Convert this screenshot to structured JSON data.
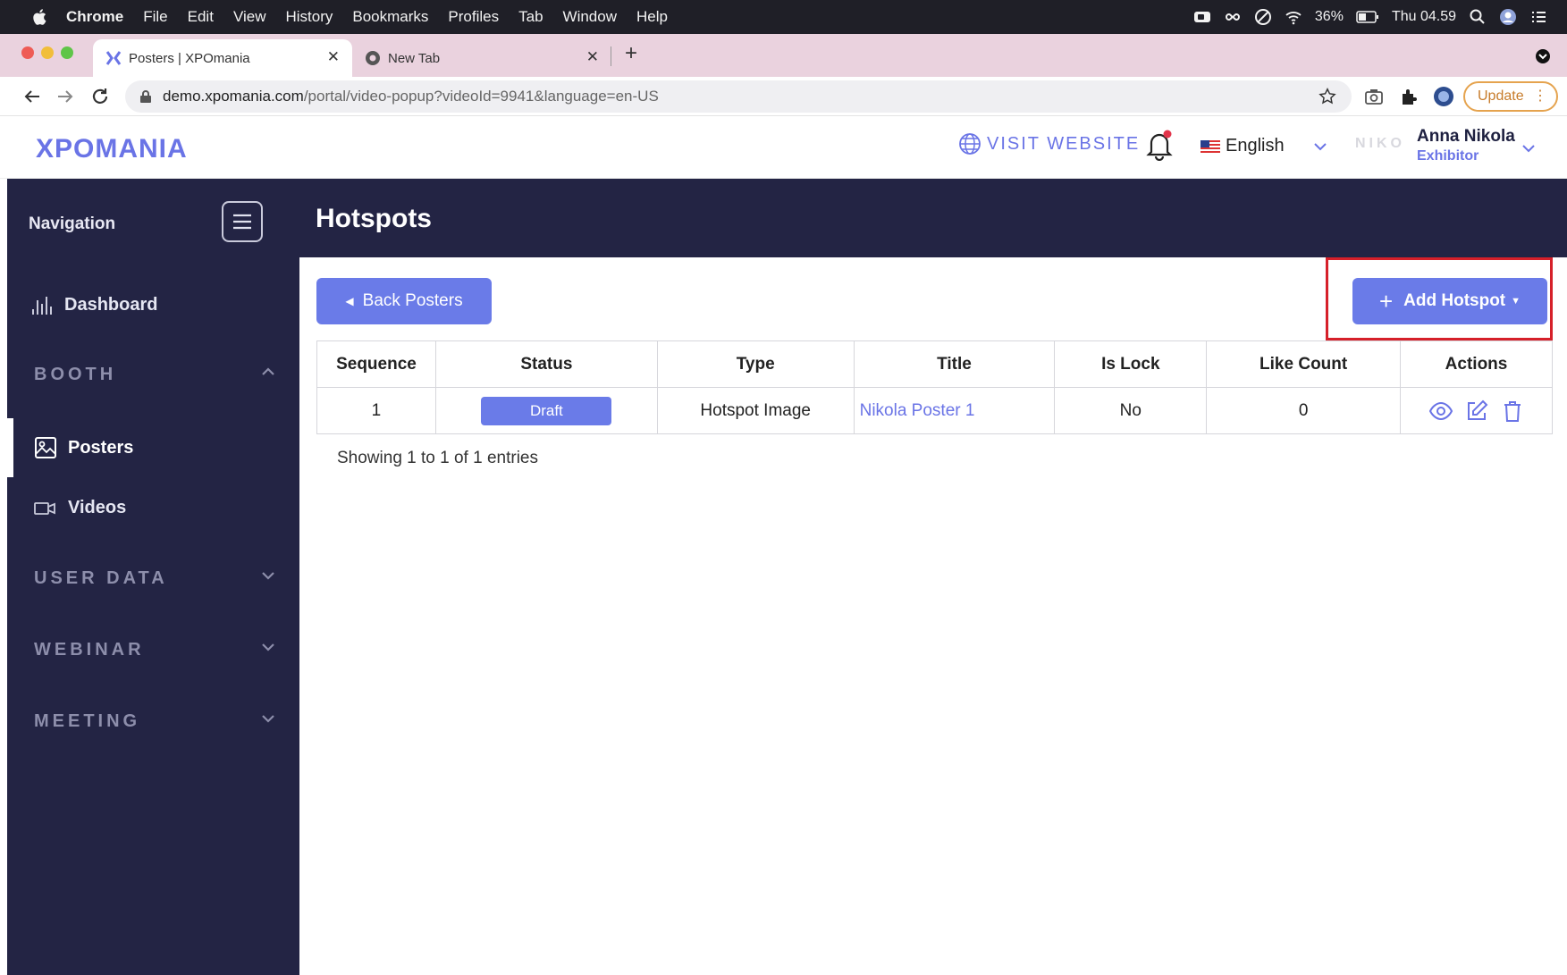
{
  "menubar": {
    "app": "Chrome",
    "items": [
      "File",
      "Edit",
      "View",
      "History",
      "Bookmarks",
      "Profiles",
      "Tab",
      "Window",
      "Help"
    ],
    "battery": "36%",
    "clock": "Thu 04.59"
  },
  "browser": {
    "tabs": [
      {
        "label": "Posters | XPOmania",
        "active": true
      },
      {
        "label": "New Tab",
        "active": false
      }
    ],
    "url_host": "demo.xpomania.com",
    "url_path": "/portal/video-popup?videoId=9941&language=en-US",
    "update_label": "Update"
  },
  "header": {
    "logo_text": "XPOMANIA",
    "visit_website": "VISIT WEBSITE",
    "language": "English",
    "company_faint": "NIKO",
    "user_name": "Anna Nikola",
    "user_role": "Exhibitor"
  },
  "sidebar": {
    "title": "Navigation",
    "dashboard": "Dashboard",
    "sections": {
      "booth": "BOOTH",
      "user_data": "USER DATA",
      "webinar": "WEBINAR",
      "meeting": "MEETING"
    },
    "posters": "Posters",
    "videos": "Videos"
  },
  "page": {
    "title": "Hotspots",
    "back_button": "Back Posters",
    "add_button": "Add Hotspot",
    "entries_info": "Showing 1 to 1 of 1 entries"
  },
  "table": {
    "columns": [
      "Sequence",
      "Status",
      "Type",
      "Title",
      "Is Lock",
      "Like Count",
      "Actions"
    ],
    "rows": [
      {
        "sequence": "1",
        "status": "Draft",
        "type": "Hotspot Image",
        "title": "Nikola Poster 1",
        "is_lock": "No",
        "like_count": "0"
      }
    ]
  },
  "colors": {
    "accent": "#6a7be8",
    "sidebar_bg": "#232444",
    "highlight": "#d6202a",
    "link": "#6a74e6"
  }
}
